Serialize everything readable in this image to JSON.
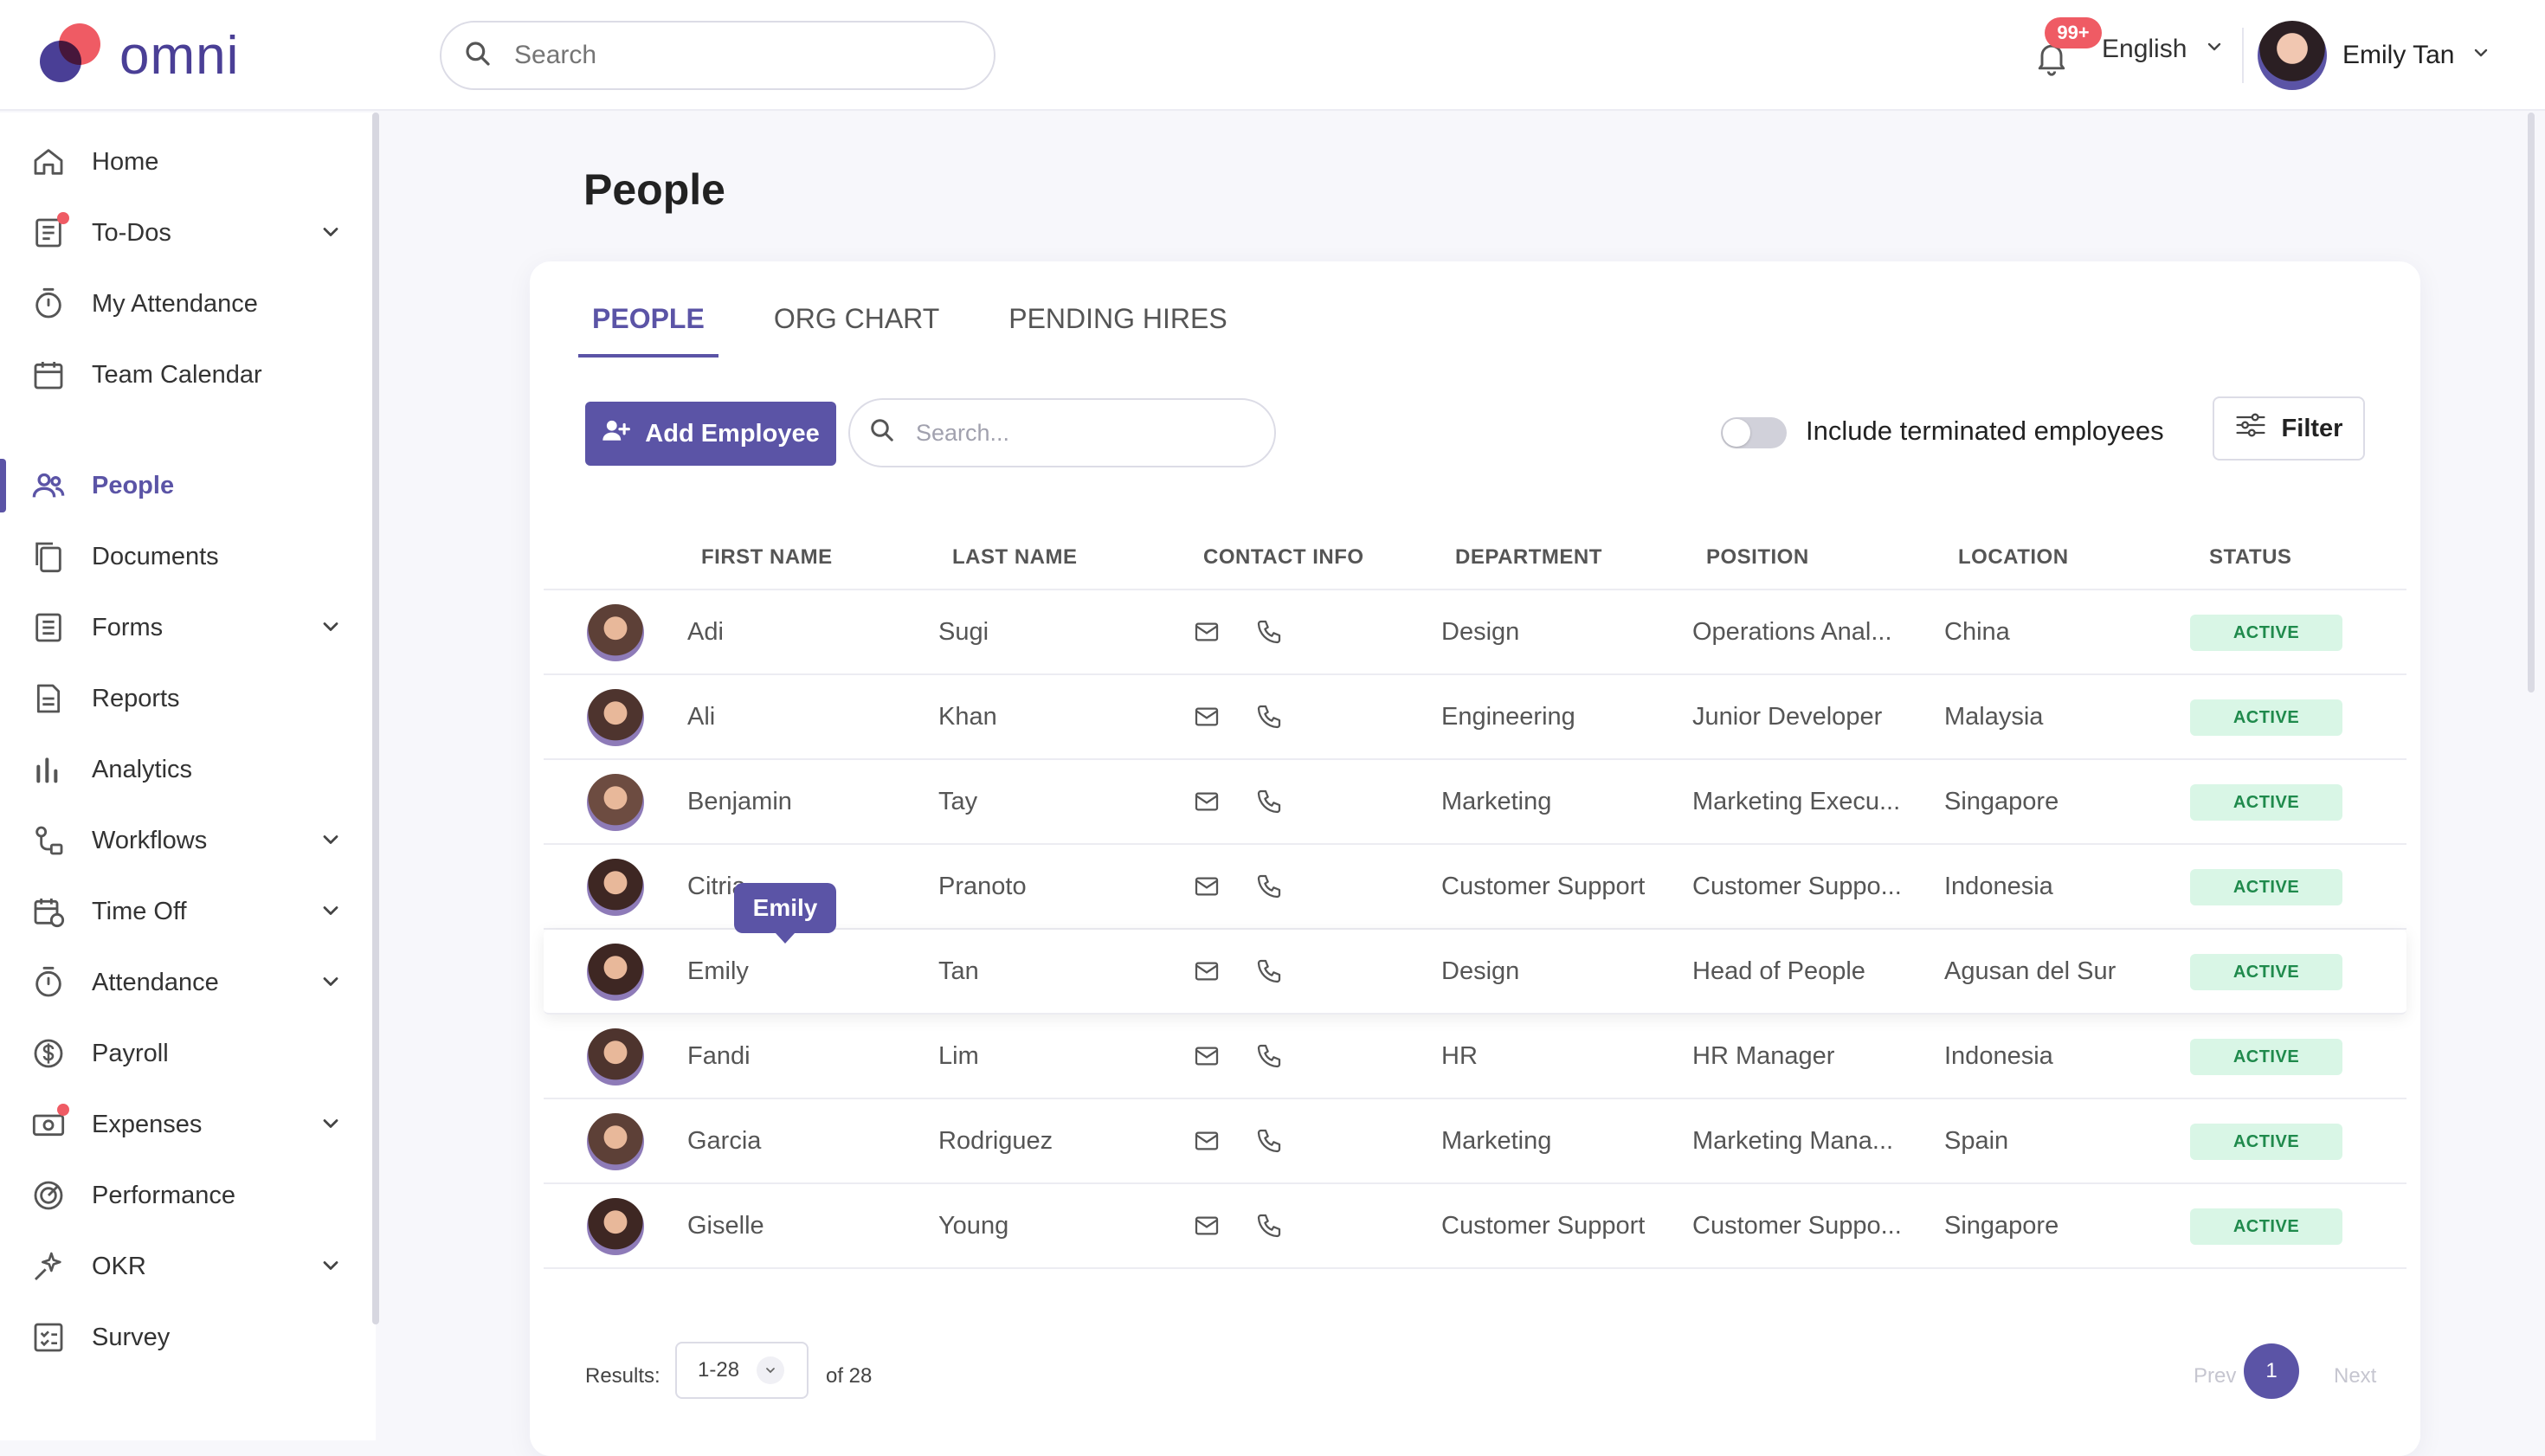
{
  "app": {
    "logo_text": "omni"
  },
  "topbar": {
    "search_placeholder": "Search",
    "notifications_count": "99+",
    "language": "English",
    "user_name": "Emily Tan"
  },
  "sidebar": {
    "items": [
      {
        "label": "Home",
        "icon": "home-icon",
        "has_chevron": false
      },
      {
        "label": "To-Dos",
        "icon": "todo-list-icon",
        "has_chevron": true,
        "dot": true
      },
      {
        "label": "My Attendance",
        "icon": "stopwatch-icon",
        "has_chevron": false
      },
      {
        "label": "Team Calendar",
        "icon": "calendar-icon",
        "has_chevron": false
      },
      {
        "label": "People",
        "icon": "people-icon",
        "has_chevron": false,
        "active": true
      },
      {
        "label": "Documents",
        "icon": "documents-icon",
        "has_chevron": false
      },
      {
        "label": "Forms",
        "icon": "form-icon",
        "has_chevron": true
      },
      {
        "label": "Reports",
        "icon": "report-icon",
        "has_chevron": false
      },
      {
        "label": "Analytics",
        "icon": "bar-chart-icon",
        "has_chevron": false
      },
      {
        "label": "Workflows",
        "icon": "workflow-icon",
        "has_chevron": true
      },
      {
        "label": "Time Off",
        "icon": "calendar-clock-icon",
        "has_chevron": true
      },
      {
        "label": "Attendance",
        "icon": "stopwatch-icon",
        "has_chevron": true
      },
      {
        "label": "Payroll",
        "icon": "dollar-icon",
        "has_chevron": false
      },
      {
        "label": "Expenses",
        "icon": "money-icon",
        "has_chevron": true,
        "dot": true
      },
      {
        "label": "Performance",
        "icon": "target-icon",
        "has_chevron": false
      },
      {
        "label": "OKR",
        "icon": "sparkle-icon",
        "has_chevron": true
      },
      {
        "label": "Survey",
        "icon": "checklist-icon",
        "has_chevron": false
      }
    ]
  },
  "page": {
    "title": "People",
    "tabs": [
      "PEOPLE",
      "ORG CHART",
      "PENDING HIRES"
    ],
    "add_employee_label": "Add Employee",
    "table_search_placeholder": "Search...",
    "toggle_label": "Include terminated employees",
    "filter_label": "Filter"
  },
  "table": {
    "headers": [
      "FIRST NAME",
      "LAST NAME",
      "CONTACT INFO",
      "DEPARTMENT",
      "POSITION",
      "LOCATION",
      "STATUS"
    ],
    "rows": [
      {
        "first": "Adi",
        "last": "Sugi",
        "department": "Design",
        "position": "Operations Anal...",
        "location": "China",
        "status": "ACTIVE",
        "avatar_color": "#5d4037"
      },
      {
        "first": "Ali",
        "last": "Khan",
        "department": "Engineering",
        "position": "Junior Developer",
        "location": "Malaysia",
        "status": "ACTIVE",
        "avatar_color": "#4e342e"
      },
      {
        "first": "Benjamin",
        "last": "Tay",
        "department": "Marketing",
        "position": "Marketing Execu...",
        "location": "Singapore",
        "status": "ACTIVE",
        "avatar_color": "#6d4c41"
      },
      {
        "first": "Citria",
        "last": "Pranoto",
        "department": "Customer Support",
        "position": "Customer Suppo...",
        "location": "Indonesia",
        "status": "ACTIVE",
        "avatar_color": "#3e2723"
      },
      {
        "first": "Emily",
        "last": "Tan",
        "department": "Design",
        "position": "Head of People",
        "location": "Agusan del Sur",
        "status": "ACTIVE",
        "avatar_color": "#3e2723"
      },
      {
        "first": "Fandi",
        "last": "Lim",
        "department": "HR",
        "position": "HR Manager",
        "location": "Indonesia",
        "status": "ACTIVE",
        "avatar_color": "#4e342e"
      },
      {
        "first": "Garcia",
        "last": "Rodriguez",
        "department": "Marketing",
        "position": "Marketing Mana...",
        "location": "Spain",
        "status": "ACTIVE",
        "avatar_color": "#5d4037"
      },
      {
        "first": "Giselle",
        "last": "Young",
        "department": "Customer Support",
        "position": "Customer Suppo...",
        "location": "Singapore",
        "status": "ACTIVE",
        "avatar_color": "#3e2723"
      }
    ],
    "tooltip": "Emily"
  },
  "pagination": {
    "results_label": "Results:",
    "range": "1-28",
    "of_label": "of 28",
    "prev": "Prev",
    "current_page": "1",
    "next": "Next"
  },
  "colors": {
    "accent": "#5b54a6",
    "active_badge_bg": "#d9f6e6",
    "active_badge_text": "#1f8a4c",
    "notification_badge": "#ef5b64"
  }
}
